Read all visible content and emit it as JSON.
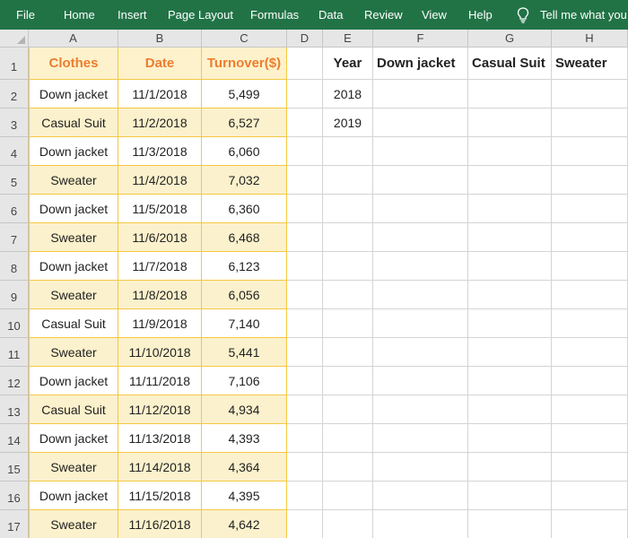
{
  "ribbon": {
    "items": [
      "File",
      "Home",
      "Insert",
      "Page Layout",
      "Formulas",
      "Data",
      "Review",
      "View",
      "Help"
    ],
    "tell_me": "Tell me what you w"
  },
  "columns": [
    "A",
    "B",
    "C",
    "D",
    "E",
    "F",
    "G",
    "H"
  ],
  "rows": [
    "1",
    "2",
    "3",
    "4",
    "5",
    "6",
    "7",
    "8",
    "9",
    "10",
    "11",
    "12",
    "13",
    "14",
    "15",
    "16",
    "17"
  ],
  "table": {
    "headers": [
      "Clothes",
      "Date",
      "Turnover($)"
    ],
    "data": [
      [
        "Down jacket",
        "11/1/2018",
        "5,499"
      ],
      [
        "Casual Suit",
        "11/2/2018",
        "6,527"
      ],
      [
        "Down jacket",
        "11/3/2018",
        "6,060"
      ],
      [
        "Sweater",
        "11/4/2018",
        "7,032"
      ],
      [
        "Down jacket",
        "11/5/2018",
        "6,360"
      ],
      [
        "Sweater",
        "11/6/2018",
        "6,468"
      ],
      [
        "Down jacket",
        "11/7/2018",
        "6,123"
      ],
      [
        "Sweater",
        "11/8/2018",
        "6,056"
      ],
      [
        "Casual Suit",
        "11/9/2018",
        "7,140"
      ],
      [
        "Sweater",
        "11/10/2018",
        "5,441"
      ],
      [
        "Down jacket",
        "11/11/2018",
        "7,106"
      ],
      [
        "Casual Suit",
        "11/12/2018",
        "4,934"
      ],
      [
        "Down jacket",
        "11/13/2018",
        "4,393"
      ],
      [
        "Sweater",
        "11/14/2018",
        "4,364"
      ],
      [
        "Down jacket",
        "11/15/2018",
        "4,395"
      ],
      [
        "Sweater",
        "11/16/2018",
        "4,642"
      ]
    ]
  },
  "summary": {
    "headers": [
      "Year",
      "Down jacket",
      "Casual Suit",
      "Sweater"
    ],
    "years": [
      "2018",
      "2019"
    ]
  },
  "colors": {
    "ribbon": "#217346",
    "table_header_text": "#ed7d31",
    "band_fill": "#fbf1cc",
    "table_border": "#f5c842"
  }
}
